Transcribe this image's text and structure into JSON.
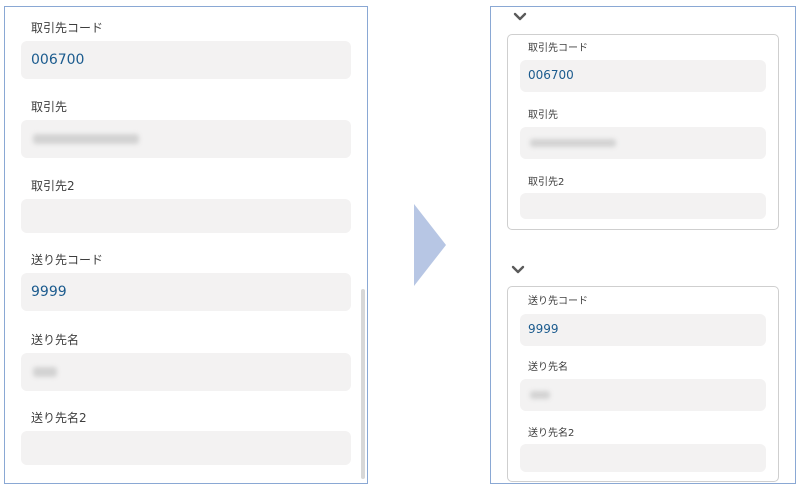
{
  "before": {
    "fields": [
      {
        "label": "取引先コード",
        "value": "006700"
      },
      {
        "label": "取引先",
        "value": ""
      },
      {
        "label": "取引先2",
        "value": ""
      },
      {
        "label": "送り先コード",
        "value": "9999"
      },
      {
        "label": "送り先名",
        "value": ""
      },
      {
        "label": "送り先名2",
        "value": ""
      }
    ]
  },
  "after": {
    "sections": [
      {
        "fields": [
          {
            "label": "取引先コード",
            "value": "006700"
          },
          {
            "label": "取引先",
            "value": ""
          },
          {
            "label": "取引先2",
            "value": ""
          }
        ]
      },
      {
        "fields": [
          {
            "label": "送り先コード",
            "value": "9999"
          },
          {
            "label": "送り先名",
            "value": ""
          },
          {
            "label": "送り先名2",
            "value": ""
          }
        ]
      }
    ]
  },
  "icons": {
    "chevron": "chevron-down-icon",
    "arrow": "right-arrow-icon"
  },
  "colors": {
    "panel_border": "#8aa8d4",
    "arrow": "#b7c6e4",
    "value_text": "#1b5b8e",
    "field_bg": "#f3f2f2"
  }
}
